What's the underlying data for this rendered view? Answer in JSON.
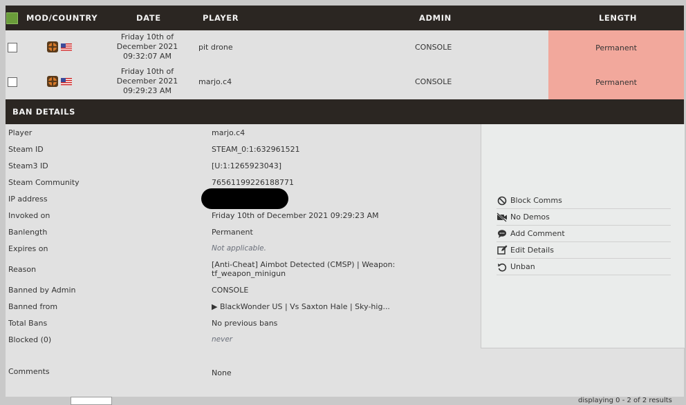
{
  "table": {
    "headers": {
      "mod_country": "MOD/COUNTRY",
      "date": "DATE",
      "player": "PLAYER",
      "admin": "ADMIN",
      "length": "LENGTH"
    },
    "rows": [
      {
        "date_line1": "Friday 10th of",
        "date_line2": "December 2021",
        "date_line3": "09:32:07 AM",
        "player": "pit drone",
        "admin": "CONSOLE",
        "length": "Permanent"
      },
      {
        "date_line1": "Friday 10th of",
        "date_line2": "December 2021",
        "date_line3": "09:29:23 AM",
        "player": "marjo.c4",
        "admin": "CONSOLE",
        "length": "Permanent"
      }
    ],
    "colors": {
      "length_bg": "#f2a89c",
      "header_bg": "#2b2622",
      "select_all": "#6a9d3a"
    }
  },
  "details": {
    "title": "BAN DETAILS",
    "fields": {
      "player_label": "Player",
      "player_value": "marjo.c4",
      "steamid_label": "Steam ID",
      "steamid_value": "STEAM_0:1:632961521",
      "steam3_label": "Steam3 ID",
      "steam3_value": "[U:1:1265923043]",
      "community_label": "Steam Community",
      "community_value": "76561199226188771",
      "ip_label": "IP address",
      "invoked_label": "Invoked on",
      "invoked_value": "Friday 10th of December 2021 09:29:23 AM",
      "banlength_label": "Banlength",
      "banlength_value": "Permanent",
      "expires_label": "Expires on",
      "expires_value": "Not applicable.",
      "reason_label": "Reason",
      "reason_value_line1": "[Anti-Cheat] Aimbot Detected (CMSP) | Weapon:",
      "reason_value_line2": "tf_weapon_minigun",
      "bannedby_label": "Banned by Admin",
      "bannedby_value": "CONSOLE",
      "bannedfrom_label": "Banned from",
      "bannedfrom_value": "▶ BlackWonder US | Vs Saxton Hale | Sky-hig...",
      "totalbans_label": "Total Bans",
      "totalbans_value": "No previous bans",
      "blocked_label": "Blocked (0)",
      "blocked_value": "never",
      "comments_label": "Comments",
      "comments_value": "None"
    },
    "actions": [
      {
        "label": "Block Comms",
        "icon": "block-icon"
      },
      {
        "label": "No Demos",
        "icon": "no-video-icon"
      },
      {
        "label": "Add Comment",
        "icon": "comment-icon"
      },
      {
        "label": "Edit Details",
        "icon": "edit-icon"
      },
      {
        "label": "Unban",
        "icon": "undo-icon"
      }
    ]
  },
  "footer": {
    "text": "displaying 0 - 2 of 2 results"
  }
}
